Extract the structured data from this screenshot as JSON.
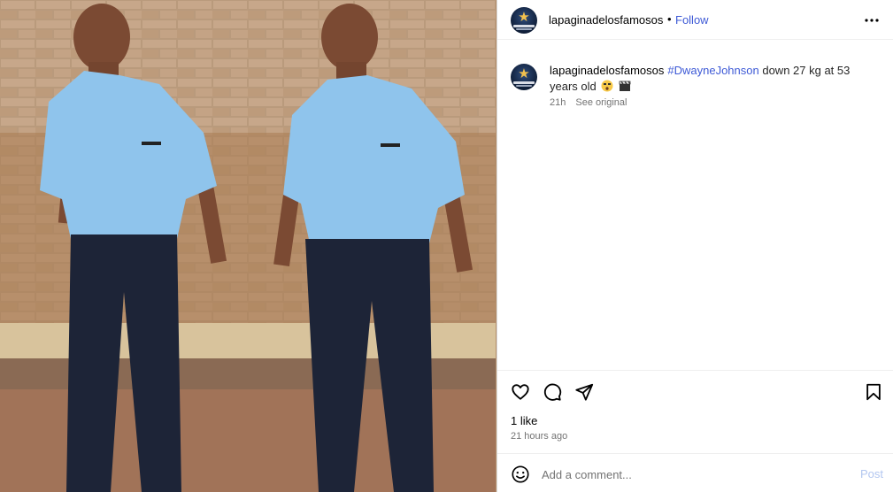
{
  "post": {
    "username": "lapaginadelosfamosos",
    "follow_label": "Follow",
    "separator": "•",
    "caption": {
      "username": "lapaginadelosfamosos",
      "hashtag": "#DwayneJohnson",
      "text": " down 27 kg at 53 years old"
    },
    "time_short": "21h",
    "see_original_label": "See original",
    "likes": "1 like",
    "time_ago": "21 hours ago"
  },
  "comment": {
    "placeholder": "Add a comment...",
    "post_label": "Post"
  },
  "icons": {
    "more": "more-options-icon",
    "like": "heart-icon",
    "comment": "comment-icon",
    "share": "share-icon",
    "save": "bookmark-icon",
    "emoji": "emoji-icon"
  },
  "colors": {
    "link": "#3e5ad6",
    "post_button_disabled": "#b2c6f0",
    "secondary_text": "#737373"
  }
}
